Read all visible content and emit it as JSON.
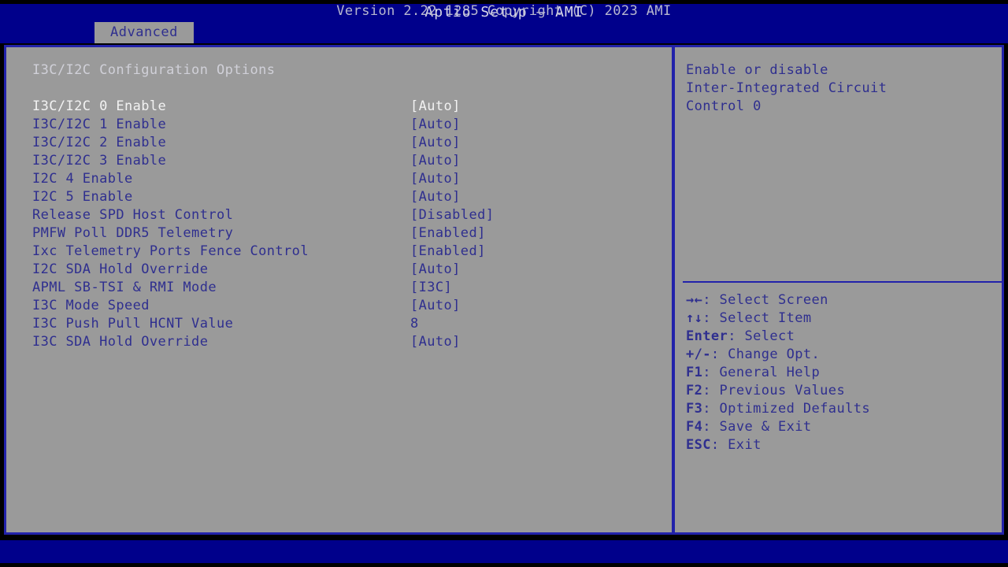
{
  "app": {
    "title": "Aptio Setup – AMI",
    "version_footer": "Version 2.22.1285 Copyright (C) 2023 AMI"
  },
  "colors": {
    "background_blue": "#00008b",
    "panel_gray": "#9a9a9a",
    "text_blue": "#2f2f8f",
    "selected_white": "#f2f2f2",
    "border_blue": "#2222aa"
  },
  "tabs": [
    {
      "label": "Advanced",
      "active": true
    }
  ],
  "main": {
    "section_title": "I3C/I2C Configuration Options",
    "options": [
      {
        "label": "I3C/I2C 0 Enable",
        "value": "[Auto]",
        "selected": true
      },
      {
        "label": "I3C/I2C 1 Enable",
        "value": "[Auto]",
        "selected": false
      },
      {
        "label": "I3C/I2C 2 Enable",
        "value": "[Auto]",
        "selected": false
      },
      {
        "label": "I3C/I2C 3 Enable",
        "value": "[Auto]",
        "selected": false
      },
      {
        "label": "I2C 4 Enable",
        "value": "[Auto]",
        "selected": false
      },
      {
        "label": "I2C 5 Enable",
        "value": "[Auto]",
        "selected": false
      },
      {
        "label": "Release SPD Host Control",
        "value": "[Disabled]",
        "selected": false
      },
      {
        "label": "PMFW Poll DDR5 Telemetry",
        "value": "[Enabled]",
        "selected": false
      },
      {
        "label": "Ixc Telemetry Ports Fence Control",
        "value": "[Enabled]",
        "selected": false
      },
      {
        "label": "I2C SDA Hold Override",
        "value": "[Auto]",
        "selected": false
      },
      {
        "label": "APML SB-TSI & RMI Mode",
        "value": "[I3C]",
        "selected": false
      },
      {
        "label": "I3C Mode Speed",
        "value": "[Auto]",
        "selected": false
      },
      {
        "label": "I3C Push Pull HCNT Value",
        "value": "8",
        "selected": false
      },
      {
        "label": "I3C SDA Hold Override",
        "value": "[Auto]",
        "selected": false
      }
    ]
  },
  "help": {
    "lines": [
      "Enable or disable",
      "Inter-Integrated Circuit",
      "Control 0"
    ]
  },
  "legend": [
    {
      "keys": "→←",
      "text": ": Select Screen"
    },
    {
      "keys": "↑↓",
      "text": ": Select Item"
    },
    {
      "keys": "Enter",
      "text": ": Select"
    },
    {
      "keys": "+/-",
      "text": ": Change Opt."
    },
    {
      "keys": "F1",
      "text": ": General Help"
    },
    {
      "keys": "F2",
      "text": ": Previous Values"
    },
    {
      "keys": "F3",
      "text": ": Optimized Defaults"
    },
    {
      "keys": "F4",
      "text": ": Save & Exit"
    },
    {
      "keys": "ESC",
      "text": ": Exit"
    }
  ]
}
